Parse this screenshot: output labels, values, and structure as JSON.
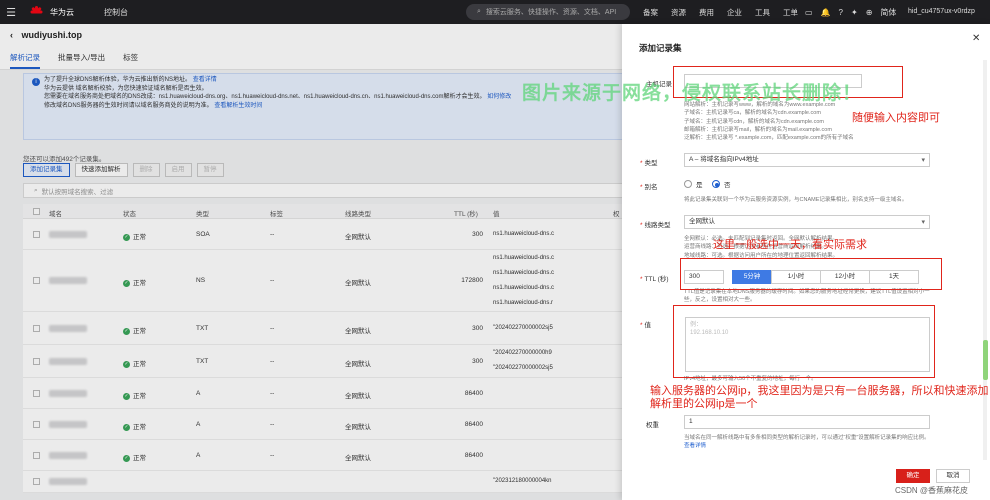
{
  "topbar": {
    "brand": "华为云",
    "brand_sub": "HUAWEI",
    "console": "控制台",
    "search_placeholder": "搜索云服务、快捷操作、资源、文档、API",
    "nav": [
      "备案",
      "资源",
      "费用",
      "企业",
      "工具",
      "工单"
    ],
    "lang": "简体",
    "user": "hid_cu4757ux-v0rdzp"
  },
  "page": {
    "title": "wudiyushi.top",
    "tabs": [
      "解析记录",
      "批量导入/导出",
      "标签"
    ]
  },
  "notice": {
    "line1": "为了提升全球DNS解析体验，华为云推出新的NS地址。",
    "line1_link": "查看详情",
    "line2": "华为云提供 域名解析校验，为您快速验证域名解析是否生效。",
    "line3": "您需要在域名服务商处把域名的DNS改成：ns1.huaweicloud-dns.org、ns1.huaweicloud-dns.net、ns1.huaweicloud-dns.cn、ns1.huaweicloud-dns.com解析才会生效。",
    "line3_link": "如何修改",
    "line4": "修改域名DNS服务器的生效时间请以域名服务商处的说明为准。",
    "line4_link": "查看解析生效时间"
  },
  "list": {
    "count_text": "您还可以添加492个记录集。",
    "buttons": [
      "添加记录集",
      "快速添加解析",
      "删除",
      "启用",
      "暂停"
    ],
    "search_placeholder": "默认按照域名搜索、过滤",
    "headers": [
      "域名",
      "状态",
      "类型",
      "标签",
      "线路类型",
      "TTL (秒)",
      "值",
      "权"
    ],
    "rows": [
      {
        "status": "正常",
        "type": "SOA",
        "tag": "--",
        "line": "全网默认",
        "ttl": "300",
        "values": [
          "ns1.huaweicloud-dns.c"
        ]
      },
      {
        "status": "正常",
        "type": "NS",
        "tag": "--",
        "line": "全网默认",
        "ttl": "172800",
        "values": [
          "ns1.huaweicloud-dns.c",
          "ns1.huaweicloud-dns.c",
          "ns1.huaweicloud-dns.c",
          "ns1.huaweicloud-dns.r"
        ]
      },
      {
        "status": "正常",
        "type": "TXT",
        "tag": "--",
        "line": "全网默认",
        "ttl": "300",
        "values": [
          "\"202402270000002sj5"
        ]
      },
      {
        "status": "正常",
        "type": "TXT",
        "tag": "--",
        "line": "全网默认",
        "ttl": "300",
        "values": [
          "\"202402270000000h9",
          "\"202402270000002sj5"
        ]
      },
      {
        "status": "正常",
        "type": "A",
        "tag": "--",
        "line": "全网默认",
        "ttl": "86400",
        "values": []
      },
      {
        "status": "正常",
        "type": "A",
        "tag": "--",
        "line": "全网默认",
        "ttl": "86400",
        "values": []
      },
      {
        "status": "正常",
        "type": "A",
        "tag": "--",
        "line": "全网默认",
        "ttl": "86400",
        "values": []
      },
      {
        "status": "",
        "type": "",
        "tag": "",
        "line": "",
        "ttl": "",
        "values": [
          "\"202312180000004kn"
        ]
      }
    ]
  },
  "drawer": {
    "title": "添加记录集",
    "host_label": "主机记录",
    "host_hints": [
      "网站解析：主机记录写www，解析的域名为www.example.com",
      "子域名：主机记录写ca，解析的域名为cdn.example.com",
      "子域名：主机记录写cdn，解析的域名为cdn.example.com",
      "邮箱解析：主机记录写mail，解析的域名为mail.example.com",
      "泛解析：主机记录写 *.example.com，匹配example.com的所有子域名"
    ],
    "type_label": "类型",
    "type_value": "A – 将域名指向IPv4地址",
    "alias_label": "别名",
    "alias_yes": "是",
    "alias_no": "否",
    "alias_hint": "将此记录集关联到一个华为云服务资源实例，与CNAME记录集相比，别名支持一级主域名。",
    "line_label": "线路类型",
    "line_value": "全网默认",
    "line_hints": [
      "全网默认：必选。未匹配到记录集时返回。全网默认解析结果。",
      "运营商线路：可选。根据访问者所在运营商返回解析结果。",
      "地域线路：可选。根据访问用户所在的地理位置返回解析结果。"
    ],
    "ttl_label": "TTL (秒)",
    "ttl_value": "300",
    "ttl_options": [
      "5分钟",
      "1小时",
      "12小时",
      "1天"
    ],
    "ttl_hint": "TTL值是记录集在本地DNS服务器的缓存时间。如果您的服务地址经常更换，建议TTL值设置相对小一些，反之，设置相对大一些。",
    "value_label": "值",
    "value_placeholder": "例：\n192.168.10.10",
    "value_hint": "IPv4地址，最多可输入50个不重复的地址，每行一个。",
    "weight_label": "权重",
    "weight_value": "1",
    "weight_hint": "当域名在同一解析线路中有多条相同类型的解析记录时，可以通过“权重”设置解析记录集的响应比例。",
    "weight_link": "查看详情",
    "ok": "确定",
    "cancel": "取消"
  },
  "annotations": {
    "a1": "随便输入内容即可",
    "a2": "这里一般选中一天，看实际需求",
    "a3_line1": "输入服务器的公网ip，我这里因为是只有一台服务器，所以和快速添加",
    "a3_line2": "解析里的公网ip是一个",
    "watermark": "图片来源于网络，侵权联系站长删除！",
    "footer": "CSDN @香蕉麻花皮"
  },
  "colors": {
    "brand_red": "#e0251b",
    "primary_blue": "#1f5fcf",
    "annotation_red": "#e0251b",
    "watermark_green": "#5fd57a"
  }
}
